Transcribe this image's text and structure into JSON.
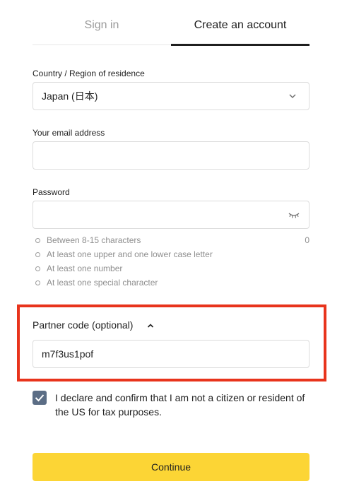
{
  "tabs": {
    "signin": "Sign in",
    "create": "Create an account"
  },
  "country": {
    "label": "Country / Region of residence",
    "value": "Japan (日本)"
  },
  "email": {
    "label": "Your email address",
    "value": ""
  },
  "password": {
    "label": "Password",
    "value": "",
    "counter": "0",
    "rules": [
      "Between 8-15 characters",
      "At least one upper and one lower case letter",
      "At least one number",
      "At least one special character"
    ]
  },
  "partner": {
    "label": "Partner code (optional)",
    "value": "m7f3us1pof"
  },
  "declaration": {
    "checked": true,
    "text": "I declare and confirm that I am not a citizen or resident of the US for tax purposes."
  },
  "continue_label": "Continue",
  "colors": {
    "accent": "#fcd535",
    "highlight": "#e8341c",
    "checkbox": "#5b6d85"
  },
  "icons": {
    "country_select": "chevron-down-icon",
    "password_toggle": "eye-closed-icon",
    "partner_toggle": "chevron-up-icon",
    "checkbox": "check-icon"
  }
}
